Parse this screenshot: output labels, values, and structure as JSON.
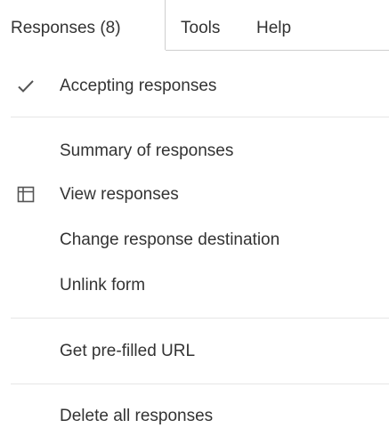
{
  "menubar": {
    "responses_label": "Responses (8)",
    "tools_label": "Tools",
    "help_label": "Help"
  },
  "menu": {
    "accepting_responses": "Accepting responses",
    "summary_of_responses": "Summary of responses",
    "view_responses": "View responses",
    "change_response_destination": "Change response destination",
    "unlink_form": "Unlink form",
    "get_prefilled_url": "Get pre-filled URL",
    "delete_all_responses": "Delete all responses"
  },
  "icons": {
    "accepting_responses": "checkmark-icon",
    "view_responses": "table-icon"
  },
  "colors": {
    "text": "#333333",
    "separator": "#e6e6e6",
    "menubar_border": "#cfcfcf"
  }
}
